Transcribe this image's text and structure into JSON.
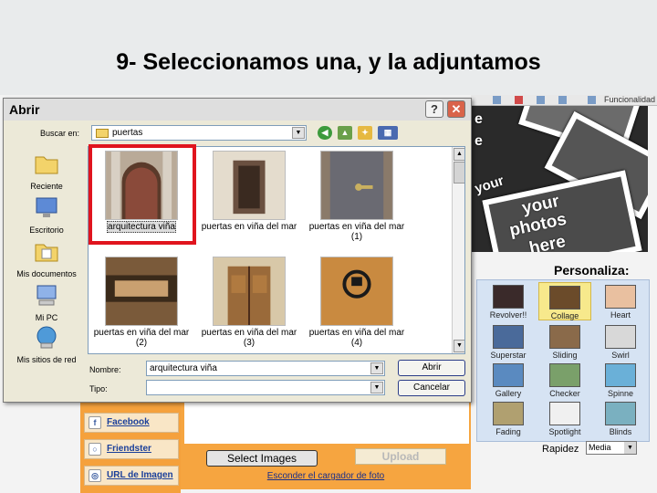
{
  "slide": {
    "title": "9- Seleccionamos una, y la adjuntamos"
  },
  "dialog": {
    "title": "Abrir",
    "help_button": "?",
    "close_button": "✕",
    "look_in_label": "Buscar en:",
    "look_in_value": "puertas",
    "places": [
      {
        "label": "Reciente",
        "icon": "recent-folder-icon"
      },
      {
        "label": "Escritorio",
        "icon": "desktop-icon"
      },
      {
        "label": "Mis documentos",
        "icon": "my-documents-icon"
      },
      {
        "label": "Mi PC",
        "icon": "my-computer-icon"
      },
      {
        "label": "Mis sitios de red",
        "icon": "network-places-icon"
      }
    ],
    "files": [
      {
        "name": "arquitectura viña",
        "selected": true
      },
      {
        "name": "puertas en viña del mar",
        "selected": false
      },
      {
        "name": "puertas en viña del mar (1)",
        "selected": false
      },
      {
        "name": "puertas en viña del mar (2)",
        "selected": false
      },
      {
        "name": "puertas en viña del mar (3)",
        "selected": false
      },
      {
        "name": "puertas en viña del mar (4)",
        "selected": false
      }
    ],
    "file_name_label": "Nombre:",
    "file_name_value": "arquitectura viña",
    "file_type_label": "Tipo:",
    "file_type_value": "",
    "open_button": "Abrir",
    "cancel_button": "Cancelar"
  },
  "background": {
    "collage_text": [
      "your",
      "photos",
      "here"
    ],
    "collage_side_text": [
      "e",
      "e",
      "your"
    ],
    "toolbar_text": "Funcionalidad",
    "personaliza_label": "Personaliza:",
    "effects": [
      {
        "label": "Revolver!!",
        "selected": false
      },
      {
        "label": "Collage",
        "selected": true
      },
      {
        "label": "Heart",
        "selected": false
      },
      {
        "label": "Superstar",
        "selected": false
      },
      {
        "label": "Sliding",
        "selected": false
      },
      {
        "label": "Swirl",
        "selected": false
      },
      {
        "label": "Gallery",
        "selected": false
      },
      {
        "label": "Checker",
        "selected": false
      },
      {
        "label": "Spinne",
        "selected": false
      },
      {
        "label": "Fading",
        "selected": false
      },
      {
        "label": "Spotlight",
        "selected": false
      },
      {
        "label": "Blinds",
        "selected": false
      }
    ],
    "rapidez_label": "Rapidez",
    "rapidez_value": "Media",
    "side_links": [
      {
        "label": "Facebook",
        "icon": "facebook-icon"
      },
      {
        "label": "Friendster",
        "icon": "friendster-icon"
      },
      {
        "label": "URL de Imagen",
        "icon": "globe-icon"
      }
    ],
    "select_images_button": "Select Images",
    "upload_button": "Upload",
    "hide_uploader_link": "Esconder el cargador de foto"
  },
  "colors": {
    "selection_highlight": "#e0141e",
    "dialog_bg": "#ece9d8",
    "orange_panel": "#f5a13c"
  }
}
